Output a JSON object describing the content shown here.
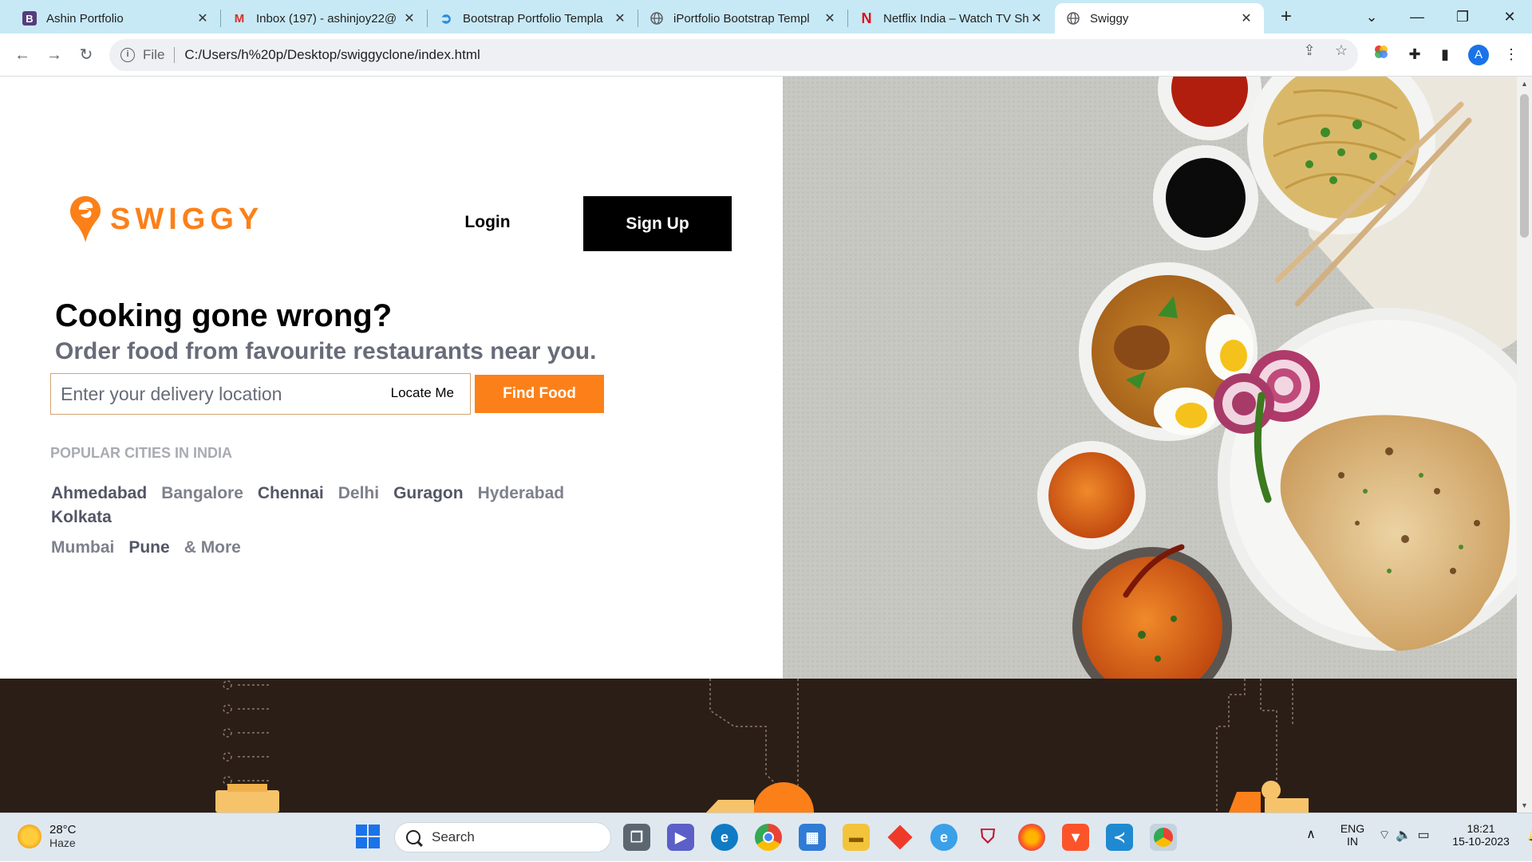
{
  "browser": {
    "tabs": [
      {
        "title": "Ashin Portfolio",
        "icon": "bootstrap-icon",
        "active": false
      },
      {
        "title": "Inbox (197) - ashinjoy22@",
        "icon": "gmail-icon",
        "active": false
      },
      {
        "title": "Bootstrap Portfolio Templa",
        "icon": "bootstrap-made-icon",
        "active": false
      },
      {
        "title": "iPortfolio Bootstrap Templ",
        "icon": "globe-icon",
        "active": false
      },
      {
        "title": "Netflix India – Watch TV Sh",
        "icon": "netflix-icon",
        "active": false
      },
      {
        "title": "Swiggy",
        "icon": "globe-icon",
        "active": true
      }
    ],
    "omnibox": {
      "scheme_label": "File",
      "url": "C:/Users/h%20p/Desktop/swiggyclone/index.html"
    },
    "profile_initial": "A"
  },
  "page": {
    "brand": "SWIGGY",
    "brand_color": "#fc8019",
    "nav": {
      "login": "Login",
      "signup": "Sign Up"
    },
    "headline": "Cooking gone wrong?",
    "subline": "Order food from favourite restaurants near you.",
    "search": {
      "placeholder": "Enter your delivery location",
      "locate_label": "Locate Me",
      "find_label": "Find Food"
    },
    "cities_heading": "POPULAR CITIES IN INDIA",
    "cities": [
      {
        "name": "Ahmedabad",
        "tone": "dark"
      },
      {
        "name": "Bangalore",
        "tone": "light"
      },
      {
        "name": "Chennai",
        "tone": "dark"
      },
      {
        "name": "Delhi",
        "tone": "light"
      },
      {
        "name": "Guragon",
        "tone": "dark"
      },
      {
        "name": "Hyderabad",
        "tone": "light"
      },
      {
        "name": "Kolkata",
        "tone": "dark"
      },
      {
        "name": "Mumbai",
        "tone": "light"
      },
      {
        "name": "Pune",
        "tone": "dark"
      },
      {
        "name": "& More",
        "tone": "light"
      }
    ]
  },
  "taskbar": {
    "weather": {
      "temp": "28°C",
      "condition": "Haze"
    },
    "search_label": "Search",
    "language": {
      "line1": "ENG",
      "line2": "IN"
    },
    "time": "18:21",
    "date": "15-10-2023"
  }
}
